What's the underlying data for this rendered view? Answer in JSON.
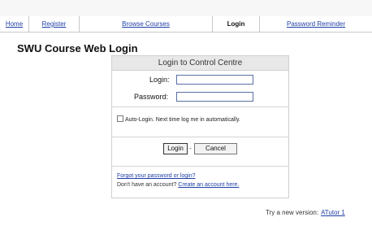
{
  "nav": {
    "items": [
      "Home",
      "Register",
      "Browse Courses",
      "Login",
      "Password Reminder"
    ],
    "active_index": 3
  },
  "page": {
    "title": "SWU Course Web Login"
  },
  "login_panel": {
    "heading": "Login to Control Centre",
    "login_label": "Login:",
    "password_label": "Password:",
    "login_value": "",
    "password_value": "",
    "auto_login_label": "Auto-Login. Next time log me in automatically.",
    "login_button": "Login",
    "separator": "-",
    "cancel_button": "Cancel",
    "forgot_link": "Forgot your password or login?",
    "no_account_text": "Don't have an account?",
    "create_account_link": "Create an account here."
  },
  "footer": {
    "try_text": "Try a new version:",
    "version_link": "ATutor 1"
  }
}
